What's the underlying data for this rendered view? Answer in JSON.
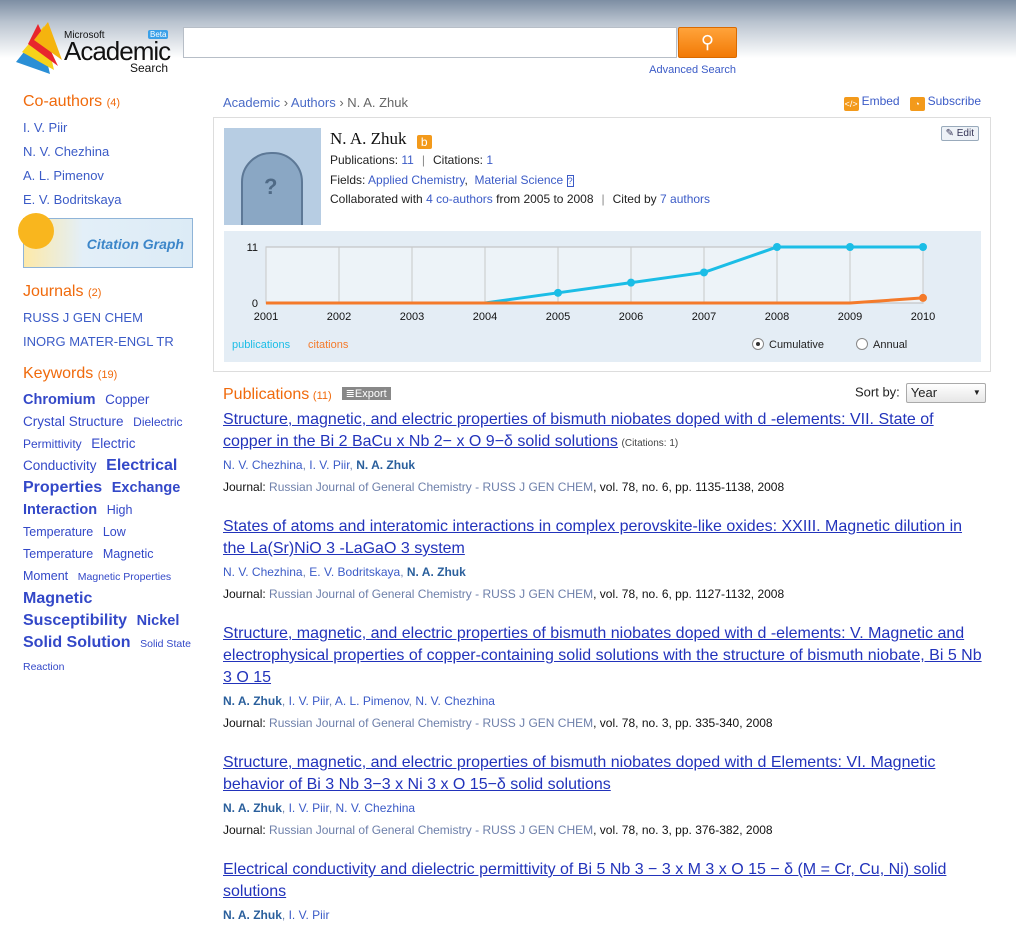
{
  "header": {
    "logo": {
      "microsoft": "Microsoft",
      "academic": "Academic",
      "search": "Search",
      "beta": "Beta"
    },
    "search_value": "",
    "advanced_search": "Advanced Search"
  },
  "left": {
    "coauthors": {
      "title": "Co-authors",
      "count": "(4)",
      "items": [
        "I. V. Piir",
        "N. V. Chezhina",
        "A. L. Pimenov",
        "E. V. Bodritskaya"
      ]
    },
    "citation_graph": "Citation Graph",
    "journals": {
      "title": "Journals",
      "count": "(2)",
      "items": [
        "RUSS J GEN CHEM",
        "INORG MATER-ENGL TR"
      ]
    },
    "keywords": {
      "title": "Keywords",
      "count": "(19)",
      "items": [
        {
          "label": "Chromium",
          "size": 3
        },
        {
          "label": "Copper",
          "size": 2
        },
        {
          "label": "Crystal Structure",
          "size": 2
        },
        {
          "label": "Dielectric Permittivity",
          "size": 1
        },
        {
          "label": "Electric Conductivity",
          "size": 2
        },
        {
          "label": "Electrical Properties",
          "size": 4
        },
        {
          "label": "Exchange Interaction",
          "size": 3
        },
        {
          "label": "High Temperature",
          "size": 1.5
        },
        {
          "label": "Low Temperature",
          "size": 1.5
        },
        {
          "label": "Magnetic Moment",
          "size": 1.5
        },
        {
          "label": "Magnetic Properties",
          "size": 0
        },
        {
          "label": "Magnetic Susceptibility",
          "size": 4
        },
        {
          "label": "Nickel",
          "size": 3
        },
        {
          "label": "Solid Solution",
          "size": 4
        },
        {
          "label": "Solid State Reaction",
          "size": 0
        }
      ]
    }
  },
  "breadcrumb": [
    "Academic",
    "Authors",
    "N. A. Zhuk"
  ],
  "actions": {
    "embed": "Embed",
    "subscribe": "Subscribe",
    "edit": "Edit"
  },
  "profile": {
    "name": "N. A. Zhuk",
    "publications_label": "Publications:",
    "publications": "11",
    "citations_label": "Citations:",
    "citations": "1",
    "fields_label": "Fields:",
    "fields": [
      "Applied Chemistry",
      "Material Science"
    ],
    "collab_pre": "Collaborated with",
    "collab_link": "4 co-authors",
    "collab_post": "from 2005 to 2008",
    "cited_pre": "Cited by",
    "cited_link": "7 authors"
  },
  "chart_data": {
    "type": "line",
    "x": [
      2001,
      2002,
      2003,
      2004,
      2005,
      2006,
      2007,
      2008,
      2009,
      2010
    ],
    "ylim": [
      0,
      11
    ],
    "yticks": [
      "0",
      "11"
    ],
    "series": [
      {
        "name": "publications",
        "color": "#1bbde6",
        "values": [
          0,
          0,
          0,
          0,
          2,
          4,
          6,
          11,
          11,
          11
        ]
      },
      {
        "name": "citations",
        "color": "#f47a2a",
        "values": [
          0,
          0,
          0,
          0,
          0,
          0,
          0,
          0,
          0,
          1
        ]
      }
    ],
    "modes": [
      "Cumulative",
      "Annual"
    ],
    "selected_mode": "Cumulative"
  },
  "publications": {
    "title": "Publications",
    "count": "(11)",
    "export": "Export",
    "sort_label": "Sort by:",
    "sort_value": "Year",
    "items": [
      {
        "title": "Structure, magnetic, and electric properties of bismuth niobates doped with d -elements: VII. State of copper in the Bi 2 BaCu x Nb 2− x O 9−δ solid solutions",
        "citations": "(Citations: 1)",
        "authors": [
          "N. V. Chezhina",
          "I. V. Piir",
          "N. A. Zhuk"
        ],
        "journal": "Russian Journal of General Chemistry - RUSS J GEN CHEM",
        "details": ", vol. 78, no. 6, pp. 1135-1138, 2008"
      },
      {
        "title": "States of atoms and interatomic interactions in complex perovskite-like oxides: XXIII. Magnetic dilution in the La(Sr)NiO 3 -LaGaO 3 system",
        "citations": "",
        "authors": [
          "N. V. Chezhina",
          "E. V. Bodritskaya",
          "N. A. Zhuk"
        ],
        "journal": "Russian Journal of General Chemistry - RUSS J GEN CHEM",
        "details": ", vol. 78, no. 6, pp. 1127-1132, 2008"
      },
      {
        "title": "Structure, magnetic, and electric properties of bismuth niobates doped with d -elements: V. Magnetic and electrophysical properties of copper-containing solid solutions with the structure of bismuth niobate, Bi 5 Nb 3 O 15",
        "citations": "",
        "authors": [
          "N. A. Zhuk",
          "I. V. Piir",
          "A. L. Pimenov",
          "N. V. Chezhina"
        ],
        "journal": "Russian Journal of General Chemistry - RUSS J GEN CHEM",
        "details": ", vol. 78, no. 3, pp. 335-340, 2008"
      },
      {
        "title": "Structure, magnetic, and electric properties of bismuth niobates doped with d Elements: VI. Magnetic behavior of Bi 3 Nb 3−3 x Ni 3 x O 15−δ solid solutions",
        "citations": "",
        "authors": [
          "N. A. Zhuk",
          "I. V. Piir",
          "N. V. Chezhina"
        ],
        "journal": "Russian Journal of General Chemistry - RUSS J GEN CHEM",
        "details": ", vol. 78, no. 3, pp. 376-382, 2008"
      },
      {
        "title": "Electrical conductivity and dielectric permittivity of Bi 5 Nb 3 − 3 x M 3 x O 15 − δ (M = Cr, Cu, Ni) solid solutions",
        "citations": "",
        "authors": [
          "N. A. Zhuk",
          "I. V. Piir"
        ],
        "journal": "",
        "details": ""
      }
    ]
  },
  "journal_label": "Journal"
}
